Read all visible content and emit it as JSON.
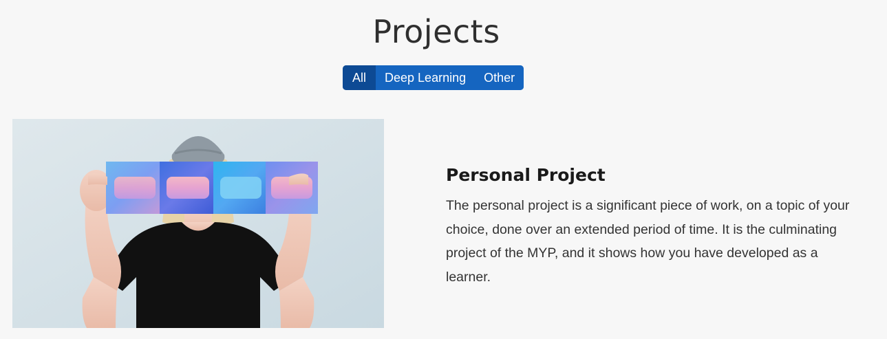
{
  "header": {
    "title": "Projects"
  },
  "filters": {
    "items": [
      {
        "label": "All",
        "active": true
      },
      {
        "label": "Deep Learning",
        "active": false
      },
      {
        "label": "Other",
        "active": false
      }
    ],
    "colors": {
      "active": "#0d4a94",
      "default": "#1565c0",
      "text": "#ffffff"
    }
  },
  "project": {
    "title": "Personal Project",
    "description": "The personal project is a significant piece of work, on a topic of your choice, done over an extended period of time. It is the culminating project of the MYP, and it shows how you have developed as a learner.",
    "image": "photo-person-holding-colorful-print"
  },
  "colors": {
    "background": "#f7f7f7",
    "heading": "#1a1a1a",
    "body_text": "#333333"
  }
}
